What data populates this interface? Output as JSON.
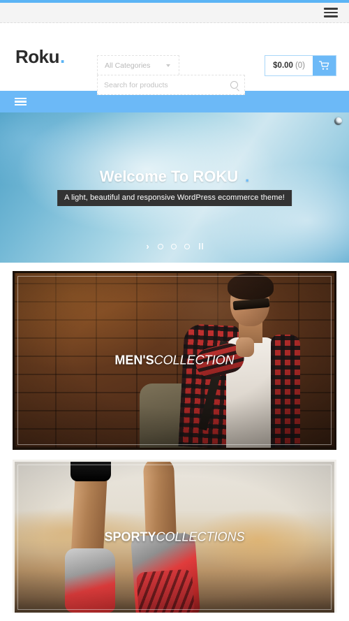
{
  "top_bar": {
    "menu_icon": "hamburger-menu-icon"
  },
  "header": {
    "logo_text": "Roku",
    "logo_dot": ".",
    "category_select": {
      "value": "All Categories",
      "caret_icon": "chevron-down-icon"
    },
    "search": {
      "placeholder": "Search for products",
      "value": "",
      "icon": "search-icon"
    },
    "cart": {
      "amount": "$0.00",
      "count": "(0)",
      "icon": "shopping-cart-icon"
    }
  },
  "navbar": {
    "menu_icon": "hamburger-menu-icon"
  },
  "hero": {
    "title": "Welcome To ROKU",
    "title_dot": ".",
    "subtitle": "A light, beautiful and responsive WordPress ecommerce theme!",
    "controls": {
      "next_label": "›",
      "dots": [
        "slide-1",
        "slide-2",
        "slide-3"
      ],
      "pause_label": "pause-icon"
    },
    "corner_badge": "slider-settings-icon"
  },
  "promos": [
    {
      "name": "mens-collection",
      "bold_text": "MEN'S",
      "italic_text": "COLLECTION"
    },
    {
      "name": "sporty-collections",
      "bold_text": "SPORTY",
      "italic_text": "COLLECTIONS"
    }
  ],
  "colors": {
    "accent_blue": "#6cb9f7",
    "top_strip_blue": "#5bb4f5",
    "top_bar_gray": "#f4f4f4",
    "dark_text": "#2b2b2b",
    "subtitle_bg": "#333333"
  }
}
